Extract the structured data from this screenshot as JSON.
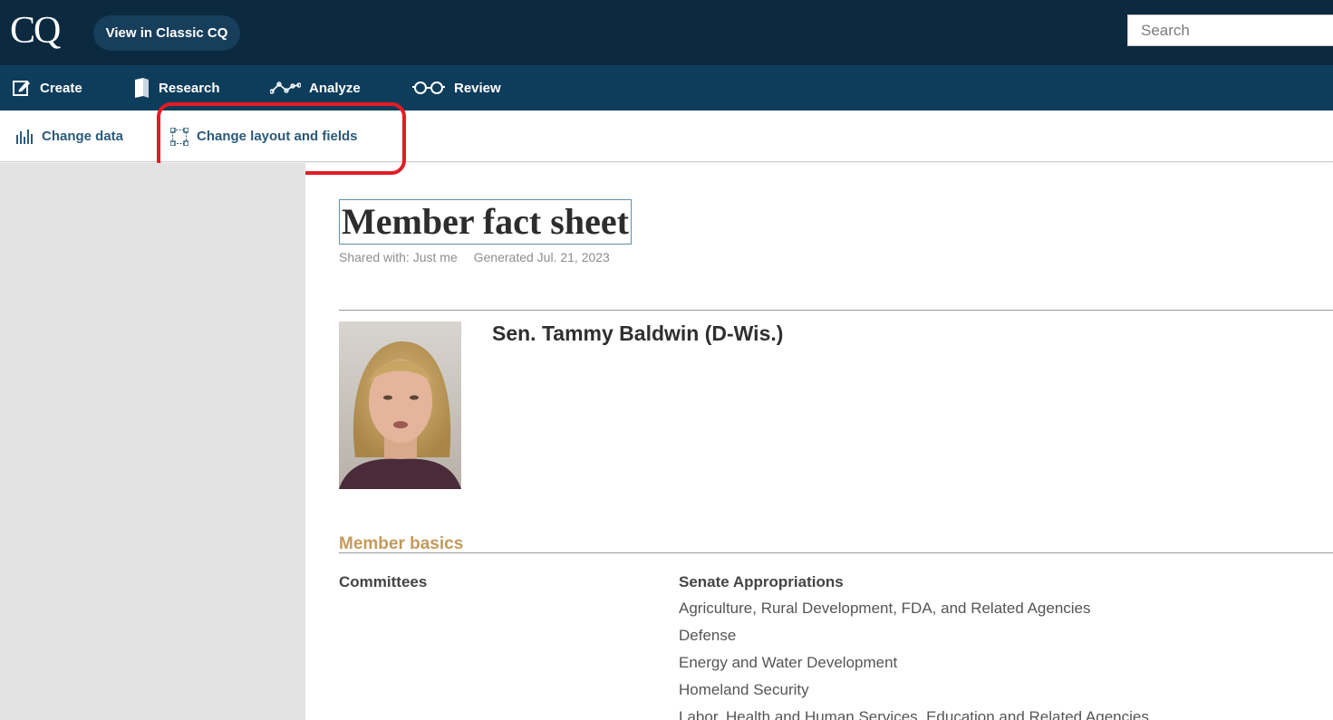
{
  "header": {
    "logo": "CQ",
    "classic_button": "View in Classic CQ",
    "search_placeholder": "Search"
  },
  "nav": {
    "items": [
      {
        "label": "Create",
        "icon": "edit-icon"
      },
      {
        "label": "Research",
        "icon": "book-icon"
      },
      {
        "label": "Analyze",
        "icon": "trend-line-icon"
      },
      {
        "label": "Review",
        "icon": "glasses-icon"
      }
    ]
  },
  "toolbar": {
    "change_data": "Change data",
    "change_layout": "Change layout and fields"
  },
  "report": {
    "title": "Member fact sheet",
    "shared_with": "Shared with: Just me",
    "generated": "Generated Jul. 21, 2023",
    "member_name": "Sen. Tammy Baldwin (D-Wis.)",
    "section_title": "Member basics",
    "committees_label": "Committees",
    "committee_name": "Senate Appropriations",
    "subcommittees": [
      "Agriculture, Rural Development, FDA, and Related Agencies",
      "Defense",
      "Energy and Water Development",
      "Homeland Security",
      "Labor, Health and Human Services, Education and Related Agencies"
    ]
  },
  "colors": {
    "topbar": "#0b2a3f",
    "navbar": "#0e3d5c",
    "toolbar_text": "#2b5a7a",
    "section_accent": "#c49a5c",
    "highlight": "#e31c24"
  }
}
